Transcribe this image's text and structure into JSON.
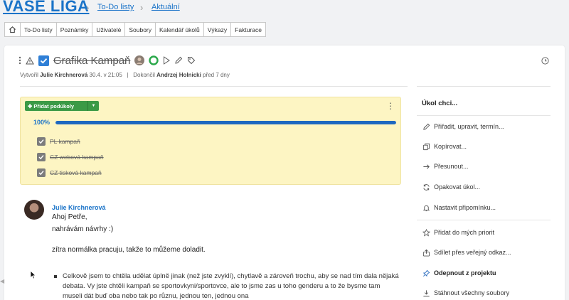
{
  "header": {
    "logo": "VAŠE LIGA",
    "breadcrumbs": [
      {
        "label": "To-Do listy"
      },
      {
        "label": "Aktuální"
      }
    ]
  },
  "tabs": [
    {
      "label": "To-Do listy"
    },
    {
      "label": "Poznámky"
    },
    {
      "label": "Uživatelé"
    },
    {
      "label": "Soubory"
    },
    {
      "label": "Kalendář úkolů"
    },
    {
      "label": "Výkazy"
    },
    {
      "label": "Fakturace"
    }
  ],
  "task": {
    "title": "Grafika Kampaň",
    "meta_created_prefix": "Vytvořil",
    "meta_created_by": "Julie Kirchnerová",
    "meta_created_at": "30.4. v 21:05",
    "meta_sep": "|",
    "meta_done_prefix": "Dokončil",
    "meta_done_by": "Andrzej Holnicki",
    "meta_done_at": "před 7 dny"
  },
  "subtasks": {
    "add_button": "Přidat podúkoly",
    "progress_label": "100%",
    "progress_value": 1.0,
    "items": [
      {
        "label": "PL kampaň",
        "checked": true
      },
      {
        "label": "CZ webová kampaň",
        "checked": true
      },
      {
        "label": "CZ tisková kampaň",
        "checked": true
      }
    ]
  },
  "comment": {
    "author": "Julie Kirchnerová",
    "line1": "Ahoj Petře,",
    "line2": "nahrávám návrhy :)",
    "line3": "zítra normálka pracuju, takže to můžeme doladit.",
    "bullet_text": "Celkově jsem to chtěla udělat úplně jinak (než jste zvyklí), chytlavě a zároveň trochu, aby se nad tím dala nějaká debata. Vy jste chtěli kampaň se sportovkyni/sportovce, ale to jsme zas u toho genderu a to že bysme tam museli dát buď oba nebo tak po různu, jednou ten, jednou ona"
  },
  "sidebar": {
    "title": "Úkol chci...",
    "items": [
      {
        "label": "Přiřadit, upravit, termín...",
        "icon": "pencil-icon"
      },
      {
        "label": "Kopírovat...",
        "icon": "copy-icon"
      },
      {
        "label": "Přesunout...",
        "icon": "arrow-right-icon"
      },
      {
        "label": "Opakovat úkol...",
        "icon": "repeat-icon"
      },
      {
        "label": "Nastavit připomínku...",
        "icon": "bell-icon"
      },
      {
        "label": "Přidat do mých priorit",
        "icon": "star-icon"
      },
      {
        "label": "Sdílet přes veřejný odkaz...",
        "icon": "share-icon"
      },
      {
        "label": "Odepnout z projektu",
        "icon": "pin-icon"
      },
      {
        "label": "Stáhnout všechny soubory",
        "icon": "download-icon"
      }
    ]
  },
  "colors": {
    "accent": "#1a73c8",
    "success": "#3b9a46",
    "subtasks_bg": "#fdf5c3"
  }
}
